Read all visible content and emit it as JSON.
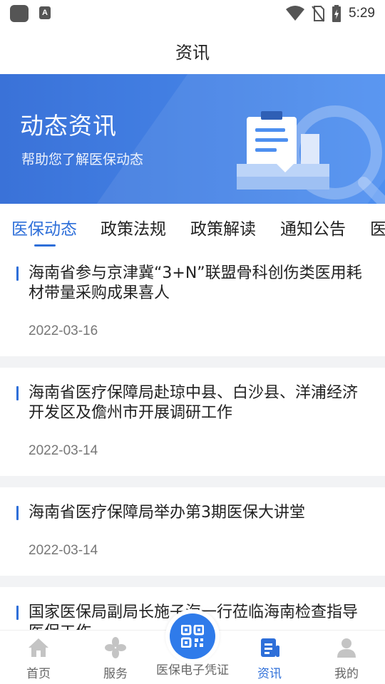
{
  "status_bar": {
    "time": "5:29",
    "app_badge": "A"
  },
  "header": {
    "title": "资讯"
  },
  "banner": {
    "title": "动态资讯",
    "subtitle": "帮助您了解医保动态"
  },
  "tabs": [
    {
      "label": "医保动态",
      "active": true
    },
    {
      "label": "政策法规",
      "active": false
    },
    {
      "label": "政策解读",
      "active": false
    },
    {
      "label": "通知公告",
      "active": false
    },
    {
      "label": "医",
      "active": false
    }
  ],
  "news": [
    {
      "title": "海南省参与京津冀“3+N”联盟骨科创伤类医用耗材带量采购成果喜人",
      "date": "2022-03-16"
    },
    {
      "title": "海南省医疗保障局赴琼中县、白沙县、洋浦经济开发区及儋州市开展调研工作",
      "date": "2022-03-14"
    },
    {
      "title": "海南省医疗保障局举办第3期医保大讲堂",
      "date": "2022-03-14"
    },
    {
      "title": "国家医保局副局长施子海一行莅临海南检查指导医保工作",
      "date": ""
    }
  ],
  "bottom_nav": [
    {
      "label": "首页",
      "icon": "home-icon",
      "active": false
    },
    {
      "label": "服务",
      "icon": "services-icon",
      "active": false
    },
    {
      "label": "医保电子凭证",
      "icon": "qr-code-icon",
      "active": false
    },
    {
      "label": "资讯",
      "icon": "news-icon",
      "active": true
    },
    {
      "label": "我的",
      "icon": "profile-icon",
      "active": false
    }
  ],
  "colors": {
    "accent": "#2e6fd9",
    "banner_start": "#3a72d8",
    "banner_end": "#4d8ff0",
    "page_background": "#f2f3f5"
  }
}
